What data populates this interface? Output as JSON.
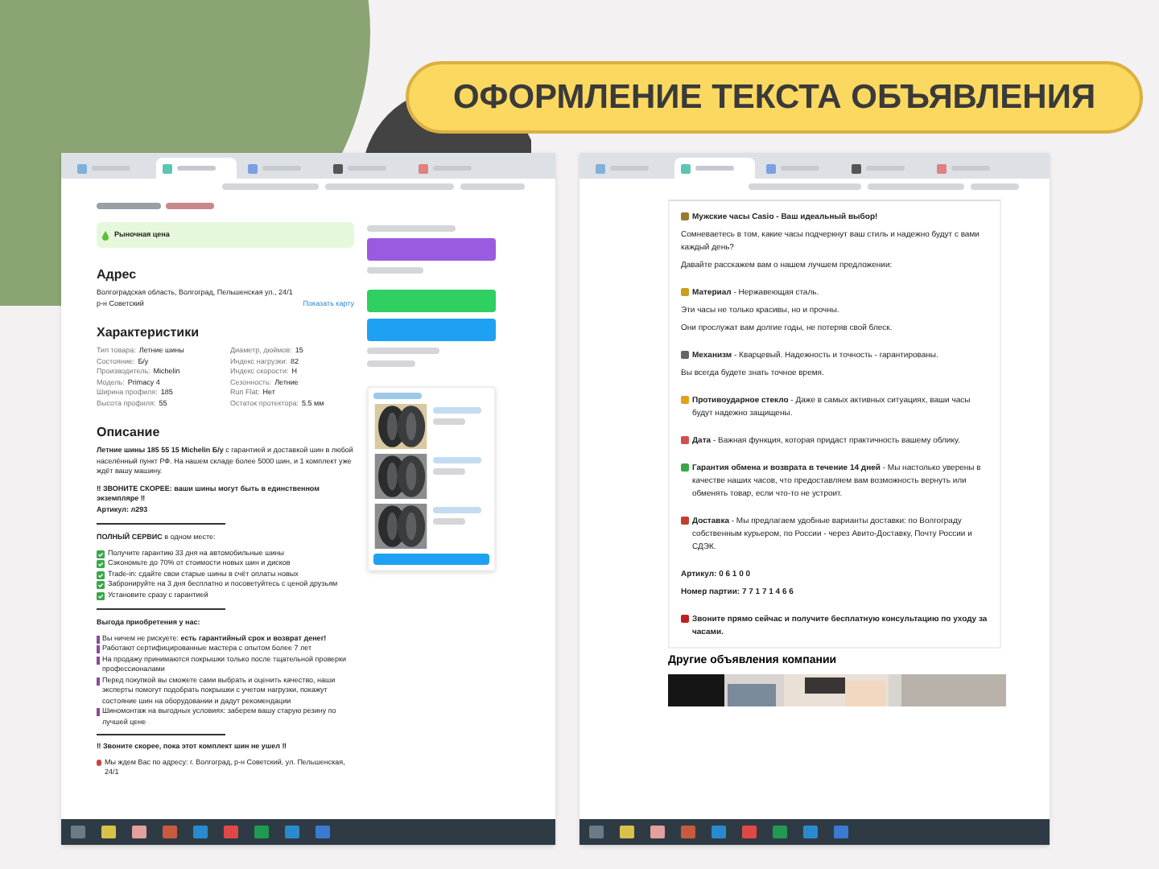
{
  "banner": {
    "title": "ОФОРМЛЕНИЕ ТЕКСТА ОБЪЯВЛЕНИЯ"
  },
  "left_screen": {
    "tabs": [
      {
        "selected": false
      },
      {
        "selected": true
      },
      {
        "selected": false
      },
      {
        "selected": false
      },
      {
        "selected": false
      }
    ],
    "price_card": {
      "title": "Рыночная цена"
    },
    "address": {
      "heading": "Адрес",
      "text": "Волгоградская область, Волгоград, Пельшенская ул., 24/1",
      "district": "р-н Советский",
      "map_link": "Показать карту"
    },
    "specs": {
      "heading": "Характеристики",
      "items": [
        {
          "label": "Тип товара:",
          "value": "Летние шины"
        },
        {
          "label": "Состояние:",
          "value": "Б/у"
        },
        {
          "label": "Производитель:",
          "value": "Michelin"
        },
        {
          "label": "Модель:",
          "value": "Primacy 4"
        },
        {
          "label": "Ширина профиля:",
          "value": "185"
        },
        {
          "label": "Высота профиля:",
          "value": "55"
        },
        {
          "label": "Диаметр, дюймов:",
          "value": "15"
        },
        {
          "label": "Индекс нагрузки:",
          "value": "82"
        },
        {
          "label": "Индекс скорости:",
          "value": "H"
        },
        {
          "label": "Сезонность:",
          "value": "Летние"
        },
        {
          "label": "Run Flat:",
          "value": "Нет"
        },
        {
          "label": "Остаток протектора:",
          "value": "5.5 мм"
        }
      ]
    },
    "description": {
      "heading": "Описание",
      "intro": "**Летние шины 185 55 15 Michelin Б/у** с гарантией и доставкой шин в любой населённый пункт РФ. На нашем складе более 5000 шин, и 1 комплект уже ждёт вашу машину.",
      "alert": "‼ ЗВОНИТЕ СКОРЕЕ: ваши шины могут быть в единственном экземпляре ‼",
      "article": "Артикул: л293",
      "service_title": "**ПОЛНЫЙ СЕРВИС** в одном месте:",
      "service_items": [
        "Получите гарантию 33 дня на автомобильные шины",
        "Сэкономьте до 70% от стоимости новых шин и дисков",
        "Trade-in: сдайте свои старые шины в счёт оплаты новых",
        "Забронируйте на 3 дня бесплатно и посоветуйтесь с ценой друзьям",
        "Установите сразу с гарантией"
      ],
      "benefits_title": "Выгода приобретения у нас:",
      "benefits": [
        "Вы ничем не рискуете: **есть гарантийный срок и возврат денег!**",
        "Работают сертифицированные мастера с опытом более 7 лет",
        "На продажу принимаются покрышки только после тщательной проверки профессионалами",
        "Перед покупкой вы сможете сами выбрать и оценить качество, наши эксперты помогут подобрать покрышки с учетом нагрузки, покажут состояние шин на оборудовании и дадут рекомендации",
        "Шиномонтаж на выгодных условиях: заберем вашу старую резину по лучшей цене"
      ],
      "call": "‼ Звоните скорее, пока этот комплект шин не ушел ‼",
      "location": "Мы ждем Вас по адресу: г. Волгоград, р-н Советский, ул. Пельшенская, 24/1"
    }
  },
  "right_screen": {
    "tabs": [
      {
        "selected": false
      },
      {
        "selected": true
      },
      {
        "selected": false
      },
      {
        "selected": false
      },
      {
        "selected": false
      }
    ],
    "blocks": [
      {
        "kind": "icon",
        "lines": [
          "**Мужские часы Casio - Ваш идеальный выбор!**",
          "Сомневаетесь в том, какие часы подчеркнут ваш стиль и надежно будут с вами каждый день?",
          "Давайте расскажем вам о нашем лучшем предложении:"
        ]
      },
      {
        "kind": "icon",
        "lines": [
          "**Материал** - Нержавеющая сталь.",
          "Эти часы не только красивы, но и прочны.",
          "Они прослужат вам долгие годы, не потеряв свой блеск."
        ]
      },
      {
        "kind": "icon",
        "lines": [
          "**Механизм** - Кварцевый. Надежность и точность - гарантированы.",
          "Вы всегда будете знать точное время."
        ]
      },
      {
        "kind": "icon",
        "lines": [
          "**Противоударное стекло** - Даже в самых активных ситуациях, ваши часы будут надежно защищены."
        ]
      },
      {
        "kind": "icon",
        "lines": [
          "**Дата** - Важная функция, которая придаст практичность вашему облику."
        ]
      },
      {
        "kind": "icon",
        "lines": [
          "**Гарантия обмена и возврата в течение 14 дней** - Мы настолько уверены в качестве наших часов, что предоставляем вам возможность вернуть или обменять товар, если что-то не устроит."
        ]
      },
      {
        "kind": "icon",
        "lines": [
          "**Доставка** - Мы предлагаем удобные варианты доставки: по Волгограду собственным курьером, по России - через Авито-Доставку, Почту России и СДЭК."
        ]
      },
      {
        "kind": "text",
        "lines": [
          "**Артикул: 0 6 1 0 0**",
          "**Номер партии: 7 7 1 7 1 4 6 6**"
        ]
      },
      {
        "kind": "icon",
        "lines": [
          "**Звоните прямо сейчас и получите бесплатную консультацию по уходу за часами.**"
        ]
      }
    ],
    "other_heading": "Другие объявления компании"
  }
}
